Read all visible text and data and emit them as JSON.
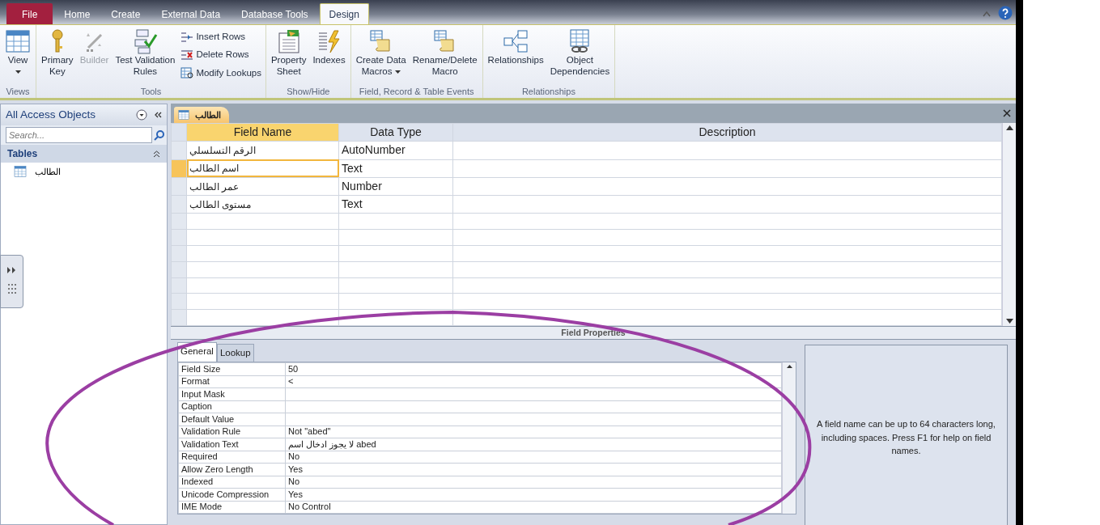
{
  "ribbon_tabs": [
    {
      "label": "File",
      "kind": "file",
      "selected": false
    },
    {
      "label": "Home",
      "kind": "tab",
      "selected": false
    },
    {
      "label": "Create",
      "kind": "tab",
      "selected": false
    },
    {
      "label": "External Data",
      "kind": "tab",
      "selected": false
    },
    {
      "label": "Database Tools",
      "kind": "tab",
      "selected": false
    },
    {
      "label": "Design",
      "kind": "tab",
      "selected": true
    }
  ],
  "ribbon_groups": [
    {
      "label": "Views",
      "items": [
        {
          "kind": "large",
          "lines": [
            "View"
          ],
          "dropdown": true,
          "disabled": false
        }
      ]
    },
    {
      "label": "Tools",
      "items": [
        {
          "kind": "large",
          "lines": [
            "Primary",
            "Key"
          ],
          "dropdown": false,
          "disabled": false
        },
        {
          "kind": "large",
          "lines": [
            "Builder"
          ],
          "dropdown": false,
          "disabled": true
        },
        {
          "kind": "large",
          "lines": [
            "Test Validation",
            "Rules"
          ],
          "dropdown": false,
          "disabled": false
        },
        {
          "kind": "stack",
          "rows": [
            {
              "label": "Insert Rows"
            },
            {
              "label": "Delete Rows"
            },
            {
              "label": "Modify Lookups"
            }
          ]
        }
      ]
    },
    {
      "label": "Show/Hide",
      "items": [
        {
          "kind": "large",
          "lines": [
            "Property",
            "Sheet"
          ],
          "dropdown": false,
          "disabled": false
        },
        {
          "kind": "large",
          "lines": [
            "Indexes"
          ],
          "dropdown": false,
          "disabled": false
        }
      ]
    },
    {
      "label": "Field, Record & Table Events",
      "items": [
        {
          "kind": "large",
          "lines": [
            "Create Data",
            "Macros"
          ],
          "dropdown": true,
          "disabled": false
        },
        {
          "kind": "large",
          "lines": [
            "Rename/Delete",
            "Macro"
          ],
          "dropdown": false,
          "disabled": false
        }
      ]
    },
    {
      "label": "Relationships",
      "items": [
        {
          "kind": "large",
          "lines": [
            "Relationships"
          ],
          "dropdown": false,
          "disabled": false
        },
        {
          "kind": "large",
          "lines": [
            "Object",
            "Dependencies"
          ],
          "dropdown": false,
          "disabled": false
        }
      ]
    }
  ],
  "nav_pane": {
    "title": "All Access Objects",
    "search": {
      "placeholder": "Search..."
    },
    "section": "Tables",
    "items": [
      {
        "label": "الطالب",
        "selected": false
      }
    ]
  },
  "document_tab": {
    "label": "الطالب"
  },
  "design_grid": {
    "columns": [
      "Field Name",
      "Data Type",
      "Description"
    ],
    "rows": [
      {
        "field_name": "الرقم التسلسلي",
        "data_type": "AutoNumber",
        "selected": false
      },
      {
        "field_name": "اسم الطالب",
        "data_type": "Text",
        "selected": true
      },
      {
        "field_name": "عمر الطالب",
        "data_type": "Number",
        "selected": false
      },
      {
        "field_name": "مستوى الطالب",
        "data_type": "Text",
        "selected": false
      }
    ]
  },
  "field_properties": {
    "title": "Field Properties",
    "tabs": [
      {
        "label": "General",
        "selected": true
      },
      {
        "label": "Lookup",
        "selected": false
      }
    ],
    "properties": [
      {
        "label": "Field Size",
        "value": "50"
      },
      {
        "label": "Format",
        "value": "<"
      },
      {
        "label": "Input Mask"
      },
      {
        "label": "Caption"
      },
      {
        "label": "Default Value"
      },
      {
        "label": "Validation Rule",
        "value": "Not \"abed\""
      },
      {
        "label": "Validation Text",
        "value": "لا يجوز ادخال اسم abed"
      },
      {
        "label": "Required",
        "value": "No"
      },
      {
        "label": "Allow Zero Length",
        "value": "Yes"
      },
      {
        "label": "Indexed",
        "value": "No"
      },
      {
        "label": "Unicode Compression",
        "value": "Yes"
      },
      {
        "label": "IME Mode",
        "value": "No Control"
      }
    ],
    "help": "A field name can be up to 64 characters long, including spaces. Press F1 for help on field names."
  }
}
